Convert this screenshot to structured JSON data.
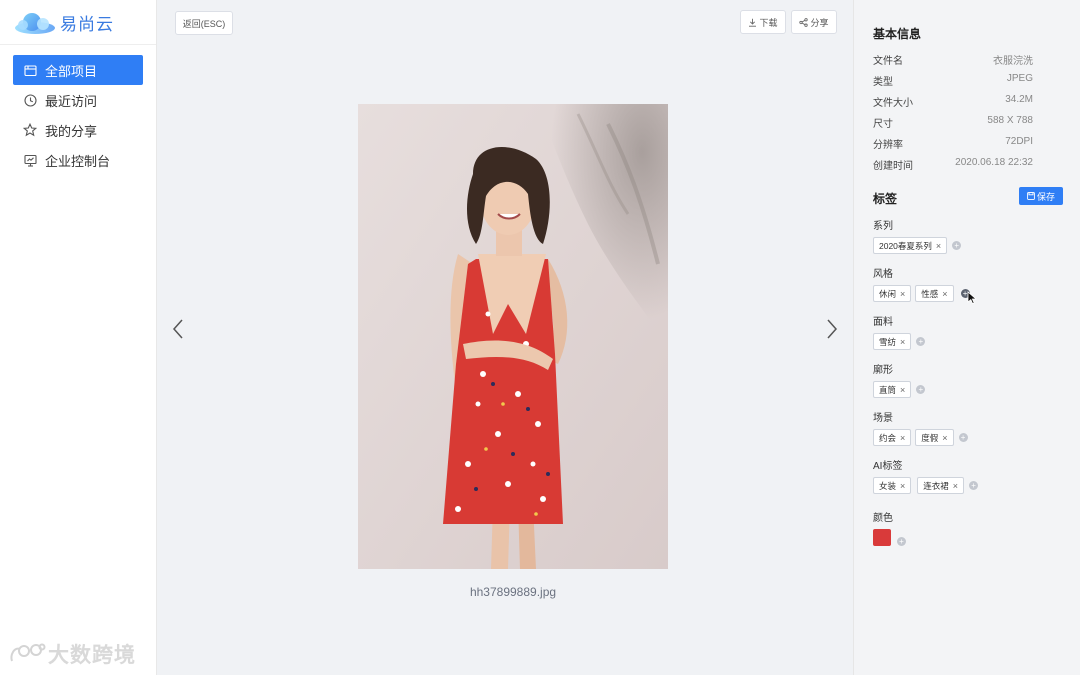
{
  "app": {
    "name": "易尚云"
  },
  "sidebar": {
    "items": [
      {
        "label": "全部项目",
        "icon": "folder-icon",
        "active": true
      },
      {
        "label": "最近访问",
        "icon": "clock-icon",
        "active": false
      },
      {
        "label": "我的分享",
        "icon": "star-icon",
        "active": false
      },
      {
        "label": "企业控制台",
        "icon": "monitor-icon",
        "active": false
      }
    ]
  },
  "watermark": {
    "text": "大数跨境"
  },
  "toolbar": {
    "back_label": "返回(ESC)",
    "download_label": "下载",
    "share_label": "分享"
  },
  "viewer": {
    "filename": "hh37899889.jpg"
  },
  "info": {
    "title": "基本信息",
    "rows": [
      {
        "label": "文件名",
        "value": "衣服浣洗"
      },
      {
        "label": "类型",
        "value": "JPEG"
      },
      {
        "label": "文件大小",
        "value": "34.2M"
      },
      {
        "label": "尺寸",
        "value": "588 X 788"
      },
      {
        "label": "分辨率",
        "value": "72DPI"
      },
      {
        "label": "创建时间",
        "value": "2020.06.18 22:32"
      }
    ]
  },
  "tags": {
    "title": "标签",
    "save_label": "保存",
    "groups": [
      {
        "label": "系列",
        "tags": [
          "2020春夏系列"
        ]
      },
      {
        "label": "风格",
        "tags": [
          "休闲",
          "性感"
        ]
      },
      {
        "label": "面料",
        "tags": [
          "雪纺"
        ]
      },
      {
        "label": "廓形",
        "tags": [
          "直筒"
        ]
      },
      {
        "label": "场景",
        "tags": [
          "约会",
          "度假"
        ]
      },
      {
        "label": "AI标签",
        "tags": [
          "女装",
          "连衣裙"
        ]
      }
    ],
    "color_label": "颜色",
    "color_value": "#d93a3a"
  },
  "colors": {
    "accent": "#2f7ef5"
  }
}
